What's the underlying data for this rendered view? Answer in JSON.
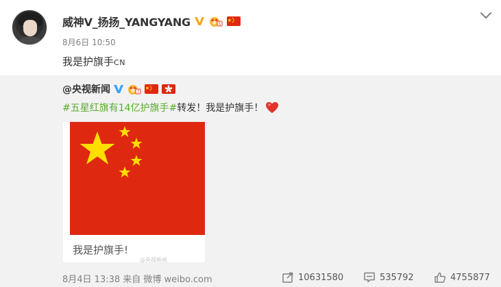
{
  "post": {
    "author": {
      "name": "威神V_扬扬_YANGYANG",
      "verified_icon": "verified-v-icon",
      "crown_icon": "vip-crown-icon",
      "flag_icon": "china-flag-emoji"
    },
    "time": "8月6日 10:50",
    "text_main": "我是护旗手",
    "text_suffix": "CN",
    "menu_icon": "chevron-down-icon"
  },
  "retweet": {
    "author": {
      "name": "@央视新闻",
      "verified_icon": "verified-v-icon",
      "crown_icon": "vip-crown-icon",
      "flag_icons": [
        "china-flag-emoji",
        "hongkong-flag-emoji"
      ]
    },
    "hashtag": "#五星红旗有14亿护旗手#",
    "text": "转发！我是护旗手！",
    "heart_icon": "red-heart-icon",
    "media": {
      "caption": "我是护旗手!",
      "watermark": "@央视新闻"
    },
    "footer": {
      "time_source": "8月4日 13:38 来自 微博 weibo.com",
      "reposts": "10631580",
      "comments": "535792",
      "likes": "4755877"
    }
  },
  "colors": {
    "hashtag": "#5aac2e",
    "flag_red": "#de2910",
    "flag_yellow": "#ffde00",
    "retweet_bg": "#f2f2f2",
    "verified_blue": "#3aa0ff",
    "verified_gold": "#f5a623"
  }
}
